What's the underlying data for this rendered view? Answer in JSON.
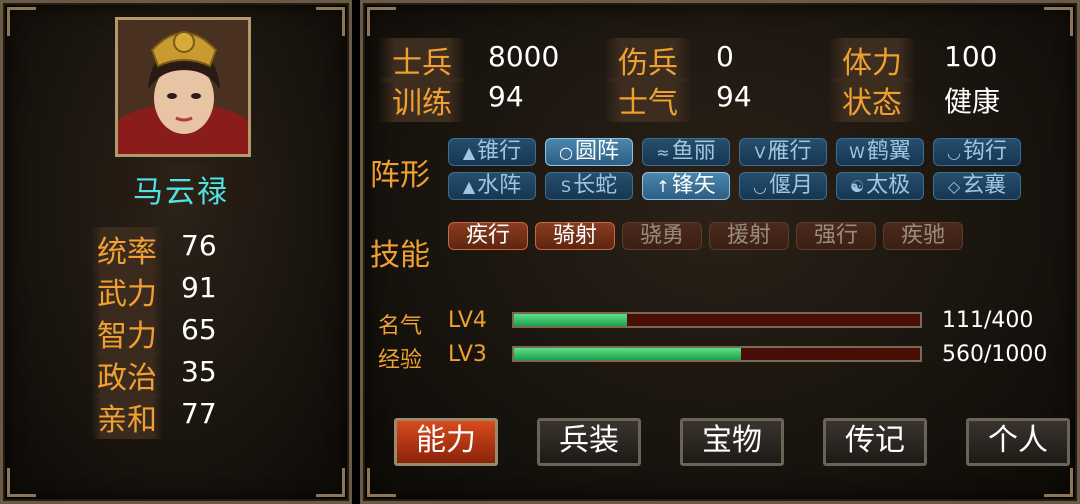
{
  "character": {
    "name": "马云禄"
  },
  "left_stats": [
    {
      "label": "统率",
      "value": "76"
    },
    {
      "label": "武力",
      "value": "91"
    },
    {
      "label": "智力",
      "value": "65"
    },
    {
      "label": "政治",
      "value": "35"
    },
    {
      "label": "亲和",
      "value": "77"
    }
  ],
  "right_stats": [
    {
      "label": "士兵",
      "value": "8000"
    },
    {
      "label": "伤兵",
      "value": "0"
    },
    {
      "label": "体力",
      "value": "100"
    },
    {
      "label": "训练",
      "value": "94"
    },
    {
      "label": "士气",
      "value": "94"
    },
    {
      "label": "状态",
      "value": "健康"
    }
  ],
  "formation": {
    "label": "阵形",
    "items": [
      {
        "label": "锥行",
        "icon": "wedge-icon",
        "selected": false
      },
      {
        "label": "圆阵",
        "icon": "circle-icon",
        "selected": true
      },
      {
        "label": "鱼丽",
        "icon": "fish-scale-icon",
        "selected": false
      },
      {
        "label": "雁行",
        "icon": "goose-icon",
        "selected": false
      },
      {
        "label": "鹤翼",
        "icon": "crane-wing-icon",
        "selected": false
      },
      {
        "label": "钩行",
        "icon": "hook-icon",
        "selected": false
      },
      {
        "label": "水阵",
        "icon": "water-icon",
        "selected": false
      },
      {
        "label": "长蛇",
        "icon": "snake-icon",
        "selected": false
      },
      {
        "label": "锋矢",
        "icon": "arrow-icon",
        "selected": true
      },
      {
        "label": "偃月",
        "icon": "crescent-icon",
        "selected": false
      },
      {
        "label": "太极",
        "icon": "taiji-icon",
        "selected": false
      },
      {
        "label": "玄襄",
        "icon": "xuanxiang-icon",
        "selected": false
      }
    ]
  },
  "skills": {
    "label": "技能",
    "items": [
      {
        "label": "疾行",
        "learned": true
      },
      {
        "label": "骑射",
        "learned": true
      },
      {
        "label": "骁勇",
        "learned": false
      },
      {
        "label": "援射",
        "learned": false
      },
      {
        "label": "强行",
        "learned": false
      },
      {
        "label": "疾驰",
        "learned": false
      }
    ]
  },
  "progress": [
    {
      "label": "名气",
      "level": "LV4",
      "current": 111,
      "max": 400,
      "text": "111/400"
    },
    {
      "label": "经验",
      "level": "LV3",
      "current": 560,
      "max": 1000,
      "text": "560/1000"
    }
  ],
  "tabs": [
    {
      "label": "能力",
      "active": true
    },
    {
      "label": "兵装",
      "active": false
    },
    {
      "label": "宝物",
      "active": false
    },
    {
      "label": "传记",
      "active": false
    },
    {
      "label": "个人",
      "active": false
    }
  ],
  "colors": {
    "accent_label": "#f0a030",
    "name": "#4fe3e3",
    "bar_fill": "#2fc060",
    "bar_track": "#4a0e08",
    "active_tab": "#d94a1e"
  }
}
